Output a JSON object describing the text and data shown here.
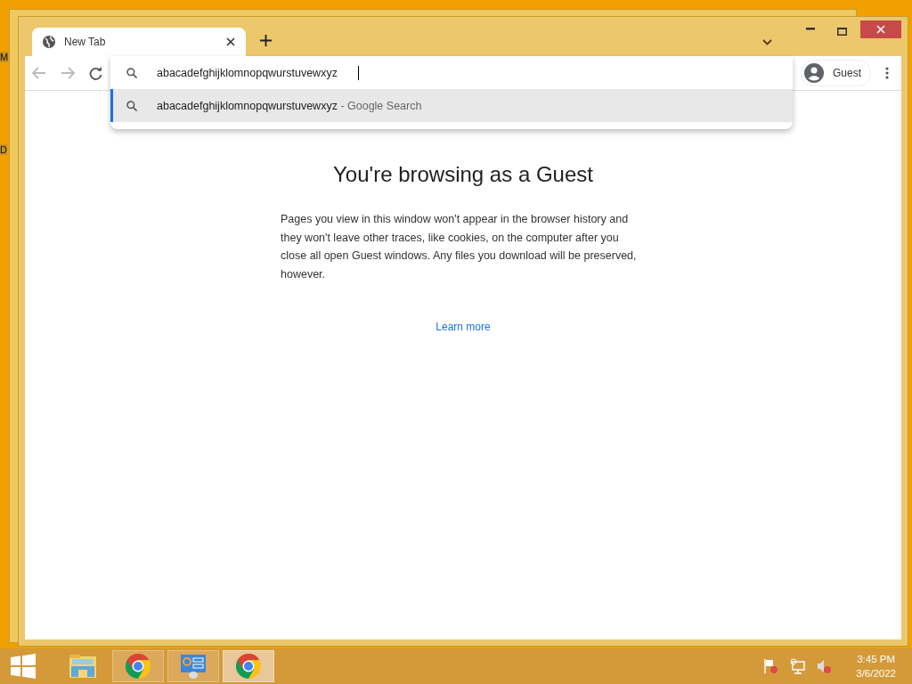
{
  "desktop_labels": [
    "M",
    "D"
  ],
  "browser": {
    "tabs": [
      {
        "title": "New Tab",
        "selected": true
      }
    ],
    "omnibox": {
      "value": "abacadefghijklomnopqwurstuvewxyz"
    },
    "suggestions": [
      {
        "text": "abacadefghijklomnopqwurstuvewxyz",
        "hint": "- Google Search",
        "selected": true
      }
    ],
    "profile": "Guest",
    "page": {
      "heading": "You're browsing as a Guest",
      "body": "Pages you view in this window won't appear in the browser history and they won't leave other traces, like cookies, on the computer after you close all open Guest windows. Any files you download will be preserved, however.",
      "link": "Learn more"
    }
  },
  "taskbar": {
    "items": [
      {
        "kind": "explorer",
        "selected": false
      },
      {
        "kind": "chrome",
        "selected": false
      },
      {
        "kind": "control",
        "selected": false
      },
      {
        "kind": "chrome",
        "selected": true
      }
    ],
    "clock": {
      "time": "3:45 PM",
      "date": "3/6/2022"
    }
  }
}
